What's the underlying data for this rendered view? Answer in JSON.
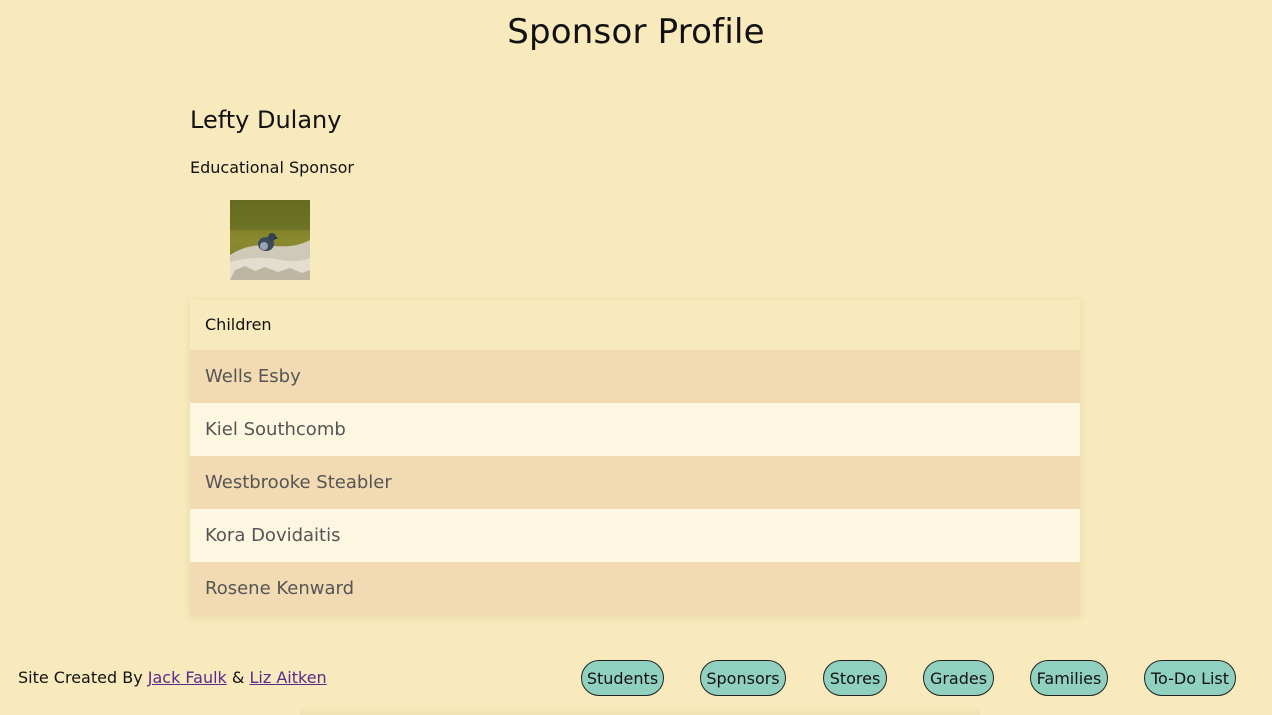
{
  "page": {
    "title": "Sponsor Profile"
  },
  "sponsor": {
    "name": "Lefty Dulany",
    "type": "Educational Sponsor",
    "photo_alt": "penguin photo"
  },
  "children": {
    "header": "Children",
    "items": [
      "Wells Esby",
      "Kiel Southcomb",
      "Westbrooke Steabler",
      "Kora Dovidaitis",
      "Rosene Kenward"
    ]
  },
  "footer": {
    "credit_prefix": "Site Created By",
    "author1": "Jack Faulk",
    "ampersand": "&",
    "author2": "Liz Aitken"
  },
  "nav": {
    "students": "Students",
    "sponsors": "Sponsors",
    "stores": "Stores",
    "grades": "Grades",
    "families": "Families",
    "todo": "To-Do List"
  },
  "colors": {
    "background": "#f8eabc",
    "row_odd": "#f2dab2",
    "row_even": "#fdf7e1",
    "nav_button": "#8fd0bf",
    "link": "#5a2a8a"
  }
}
